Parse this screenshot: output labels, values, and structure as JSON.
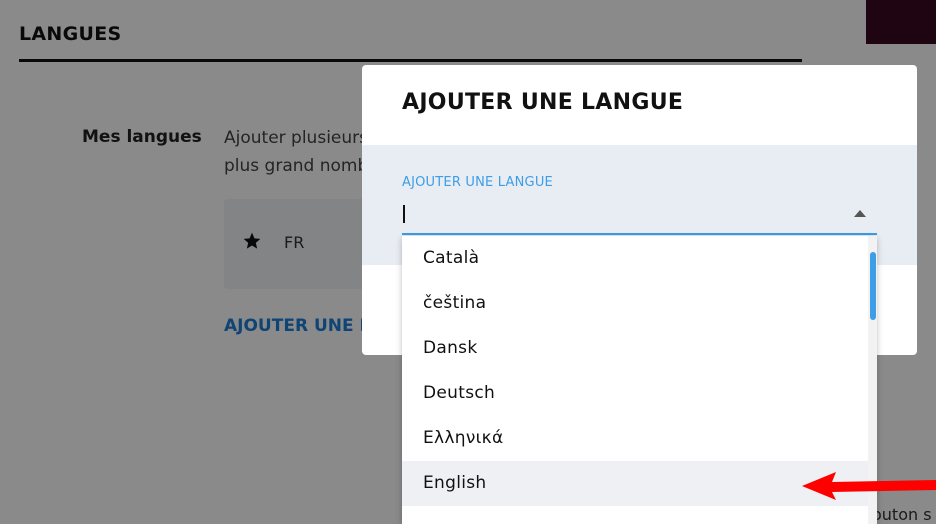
{
  "background": {
    "section_title": "LANGUES",
    "my_languages_label": "Mes langues",
    "description": "Ajouter plusieurs plus grand nomb",
    "description_line1": "Ajouter plusieurs",
    "description_line2": "plus grand nomb",
    "language_card": {
      "code": "FR",
      "icon": "star-icon"
    },
    "add_language_link": "AJOUTER UNE L",
    "right_partial_text": "outon s",
    "top_bar_color": "#3a0a22"
  },
  "modal": {
    "title": "AJOUTER UNE LANGUE",
    "field_label": "AJOUTER UNE LANGUE",
    "field_value": "",
    "accent_color": "#3d9de6"
  },
  "dropdown": {
    "options": [
      "Català",
      "čeština",
      "Dansk",
      "Deutsch",
      "Ελληνικά",
      "English"
    ],
    "highlighted": "English"
  },
  "annotation": {
    "arrow_color": "#ff0000",
    "arrow_icon": "red-arrow-left-icon"
  }
}
